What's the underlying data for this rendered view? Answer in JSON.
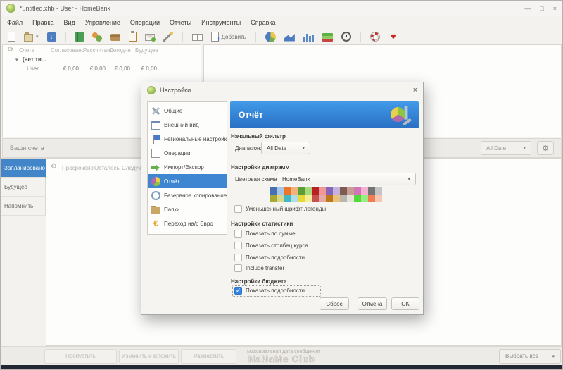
{
  "window": {
    "title": "*untitled.xhb - User - HomeBank"
  },
  "icons": {
    "gear": "⚙",
    "chevron": "▾",
    "expander": "▾",
    "heart": "♥",
    "close": "×",
    "minimize": "—",
    "maximize": "□",
    "euro": "€",
    "down_arrow": "↓"
  },
  "menu": {
    "items": [
      "Файл",
      "Правка",
      "Вид",
      "Управление",
      "Операции",
      "Отчеты",
      "Инструменты",
      "Справка"
    ]
  },
  "toolbar": {
    "add_label": "Добавить"
  },
  "accounts": {
    "headers": [
      "Счета",
      "Согласовано",
      "Рассчитано",
      "Сегодня",
      "Будущее"
    ],
    "group": "(нет ти...",
    "row_name": "User",
    "values": [
      "€ 0,00",
      "€ 0,00",
      "€ 0,00",
      "€ 0,00"
    ]
  },
  "accounts_bar": {
    "label": "Ваши счета",
    "range": "All Date"
  },
  "scheduled": {
    "tabs": [
      "Запланировано",
      "Будущее",
      "Напомнить"
    ],
    "headers": [
      "Просрочено",
      "Осталось",
      "Следующая"
    ]
  },
  "bottom": {
    "skip": "Пропустить",
    "edit_post": "Изменить и Вложить",
    "post": "Разместить",
    "note": "Максимальная дата сообщения",
    "watermark": "NaNaMe Club",
    "select_all": "Выбрать все"
  },
  "dialog": {
    "title": "Настройки",
    "nav": [
      "Общие",
      "Внешний вид",
      "Региональные настройки",
      "Операции",
      "Импорт/Экспорт",
      "Отчёт",
      "Резервное копирование",
      "Папки",
      "Переход на/с Евро"
    ],
    "header": "Отчёт",
    "filter": {
      "title": "Начальный фильтр",
      "range_label": "Диапазон:",
      "range_value": "All Date"
    },
    "charts": {
      "title": "Настройки диаграмм",
      "scheme_label": "Цветовая схема:",
      "scheme_value": "HomeBank",
      "legend_checkbox": "Уменьшенный шрифт легенды",
      "palette_row1": [
        "#4771b2",
        "#a9c5e8",
        "#e8762c",
        "#f2b279",
        "#5a9e3a",
        "#a8d878",
        "#b82025",
        "#f09898",
        "#8666b8",
        "#c5b3dd",
        "#7d5c4f",
        "#c79c94",
        "#d373b8",
        "#f2b2d2",
        "#737373",
        "#c4c4c4"
      ],
      "palette_row2": [
        "#a8a832",
        "#d8d88d",
        "#42b8c4",
        "#b0dde4",
        "#e8d835",
        "#f5ed9a",
        "#c4504f",
        "#e2a9a5",
        "#bf7817",
        "#e8c27d",
        "#bab5ad",
        "#e5e2dc",
        "#52d838",
        "#98ed85",
        "#f07d52",
        "#f5c6b2"
      ]
    },
    "stats": {
      "title": "Настройки статистики",
      "checkboxes": [
        "Показать по сумме",
        "Показать столбец курса",
        "Показать подробности",
        "Include transfer"
      ]
    },
    "budget": {
      "title": "Настройки бюджета",
      "checkbox": "Показать подробности"
    },
    "buttons": {
      "reset": "Сброс",
      "cancel": "Отмена",
      "ok": "OK"
    }
  }
}
